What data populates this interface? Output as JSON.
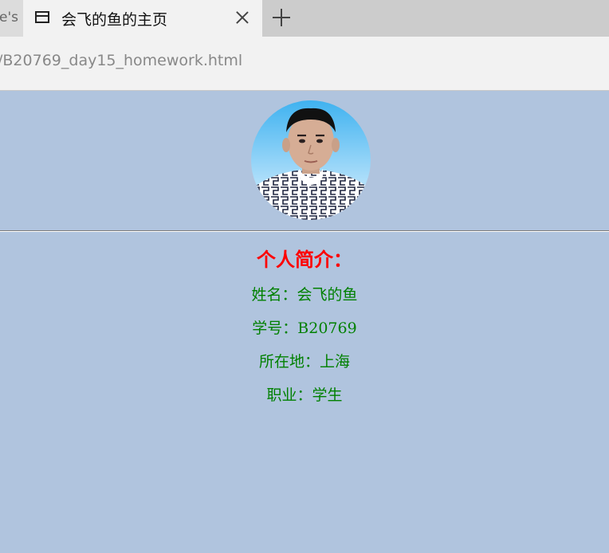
{
  "browser": {
    "prev_tab_fragment": "e's",
    "active_tab_title": "会飞的鱼的主页",
    "address": "/B20769_day15_homework.html"
  },
  "profile": {
    "heading": "个人简介：",
    "lines": [
      "姓名：会飞的鱼",
      "学号：B20769",
      "所在地：上海",
      "职业：学生"
    ]
  },
  "colors": {
    "page_background": "#b0c4de",
    "heading": "#ff0000",
    "info_text": "#008000"
  }
}
